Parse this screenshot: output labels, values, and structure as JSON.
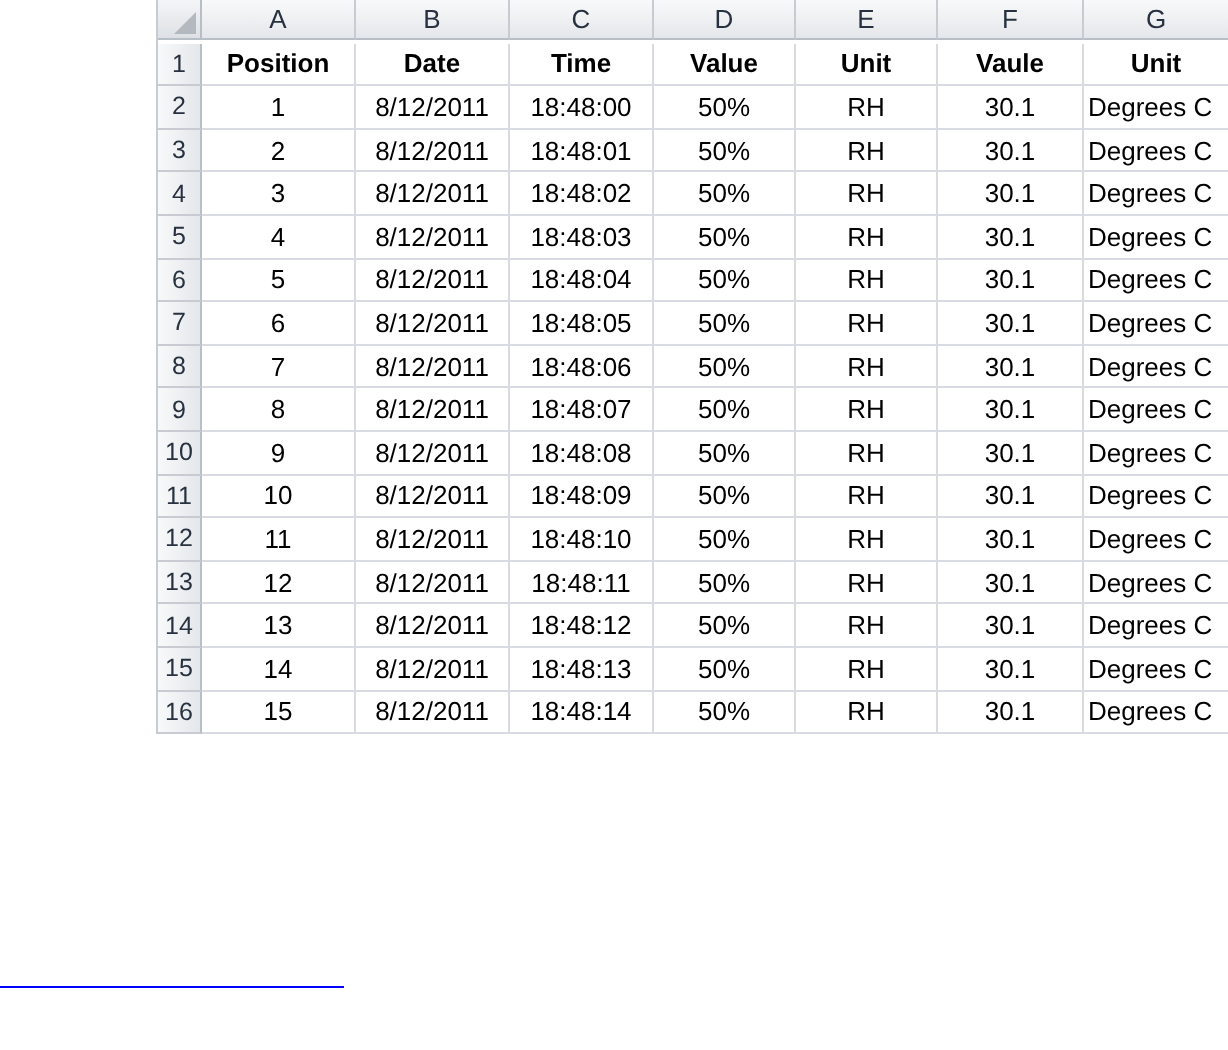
{
  "sheet": {
    "columns": [
      "A",
      "B",
      "C",
      "D",
      "E",
      "F",
      "G"
    ],
    "rows": [
      {
        "number": "1",
        "cells": [
          "Position",
          "Date",
          "Time",
          "Value",
          "Unit",
          "Vaule",
          "Unit"
        ]
      },
      {
        "number": "2",
        "cells": [
          "1",
          "8/12/2011",
          "18:48:00",
          "50%",
          "RH",
          "30.1",
          "Degrees C"
        ]
      },
      {
        "number": "3",
        "cells": [
          "2",
          "8/12/2011",
          "18:48:01",
          "50%",
          "RH",
          "30.1",
          "Degrees C"
        ]
      },
      {
        "number": "4",
        "cells": [
          "3",
          "8/12/2011",
          "18:48:02",
          "50%",
          "RH",
          "30.1",
          "Degrees C"
        ]
      },
      {
        "number": "5",
        "cells": [
          "4",
          "8/12/2011",
          "18:48:03",
          "50%",
          "RH",
          "30.1",
          "Degrees C"
        ]
      },
      {
        "number": "6",
        "cells": [
          "5",
          "8/12/2011",
          "18:48:04",
          "50%",
          "RH",
          "30.1",
          "Degrees C"
        ]
      },
      {
        "number": "7",
        "cells": [
          "6",
          "8/12/2011",
          "18:48:05",
          "50%",
          "RH",
          "30.1",
          "Degrees C"
        ]
      },
      {
        "number": "8",
        "cells": [
          "7",
          "8/12/2011",
          "18:48:06",
          "50%",
          "RH",
          "30.1",
          "Degrees C"
        ]
      },
      {
        "number": "9",
        "cells": [
          "8",
          "8/12/2011",
          "18:48:07",
          "50%",
          "RH",
          "30.1",
          "Degrees C"
        ]
      },
      {
        "number": "10",
        "cells": [
          "9",
          "8/12/2011",
          "18:48:08",
          "50%",
          "RH",
          "30.1",
          "Degrees C"
        ]
      },
      {
        "number": "11",
        "cells": [
          "10",
          "8/12/2011",
          "18:48:09",
          "50%",
          "RH",
          "30.1",
          "Degrees C"
        ]
      },
      {
        "number": "12",
        "cells": [
          "11",
          "8/12/2011",
          "18:48:10",
          "50%",
          "RH",
          "30.1",
          "Degrees C"
        ]
      },
      {
        "number": "13",
        "cells": [
          "12",
          "8/12/2011",
          "18:48:11",
          "50%",
          "RH",
          "30.1",
          "Degrees C"
        ]
      },
      {
        "number": "14",
        "cells": [
          "13",
          "8/12/2011",
          "18:48:12",
          "50%",
          "RH",
          "30.1",
          "Degrees C"
        ]
      },
      {
        "number": "15",
        "cells": [
          "14",
          "8/12/2011",
          "18:48:13",
          "50%",
          "RH",
          "30.1",
          "Degrees C"
        ]
      },
      {
        "number": "16",
        "cells": [
          "15",
          "8/12/2011",
          "18:48:14",
          "50%",
          "RH",
          "30.1",
          "Degrees C"
        ]
      }
    ]
  }
}
